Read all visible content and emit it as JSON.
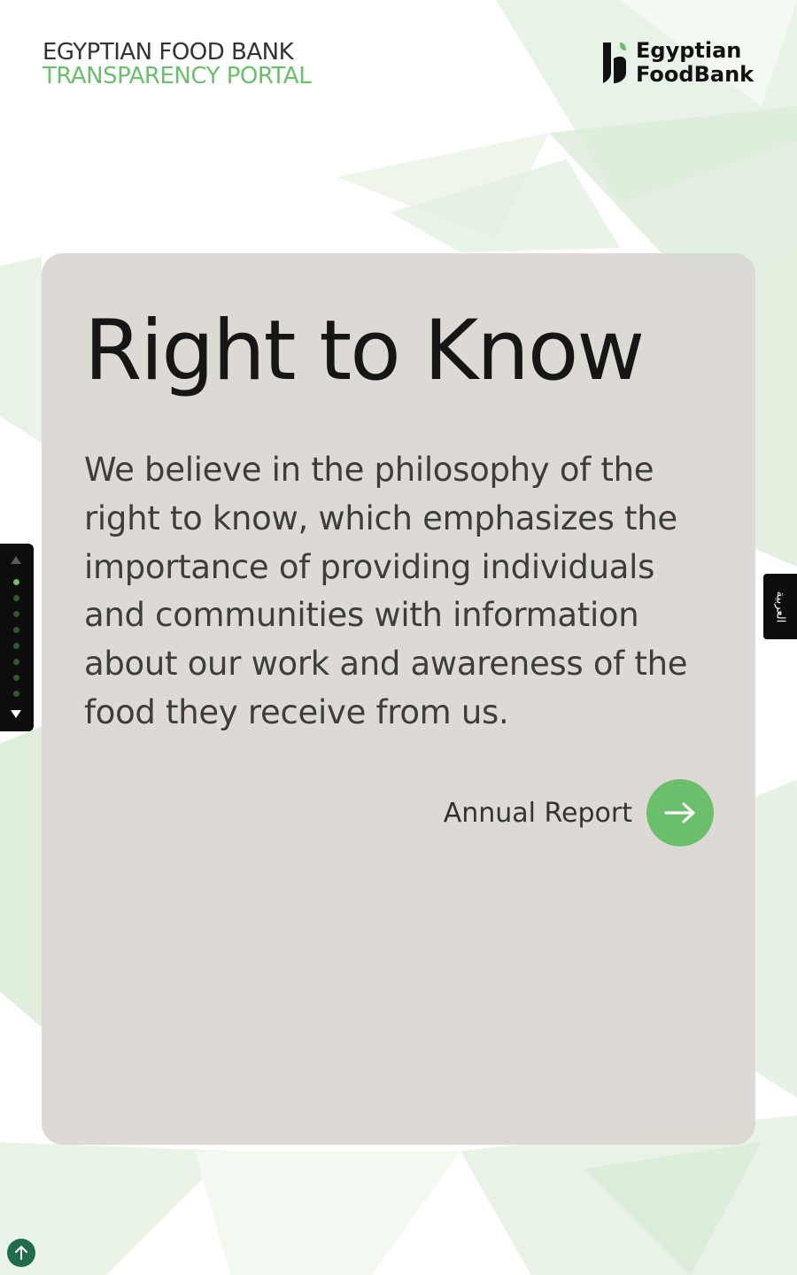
{
  "header": {
    "title_line1": "EGYPTIAN FOOD BANK",
    "title_line2": "TRANSPARENCY PORTAL"
  },
  "logo": {
    "icon": "leaf-logo-icon",
    "line1": "Egyptian",
    "line2": "FoodBank"
  },
  "card": {
    "title": "Right to Know",
    "body": "We believe in the philosophy of the right to know, which emphasizes the importance of providing individuals and communities with information about our work and awareness of the food they receive from us.",
    "cta_label": "Annual Report",
    "cta_icon": "arrow-right-icon"
  },
  "section_nav": {
    "up_icon": "triangle-up-icon",
    "down_icon": "triangle-down-icon",
    "dot_count": 8,
    "active_index": 0
  },
  "language_toggle": {
    "label": "العربية"
  },
  "scroll_top": {
    "icon": "arrow-up-icon"
  },
  "colors": {
    "accent_green": "#6bbf6b",
    "dark_green": "#1f6b4c",
    "card_bg": "#dad7d2",
    "text_dark": "#161616"
  }
}
